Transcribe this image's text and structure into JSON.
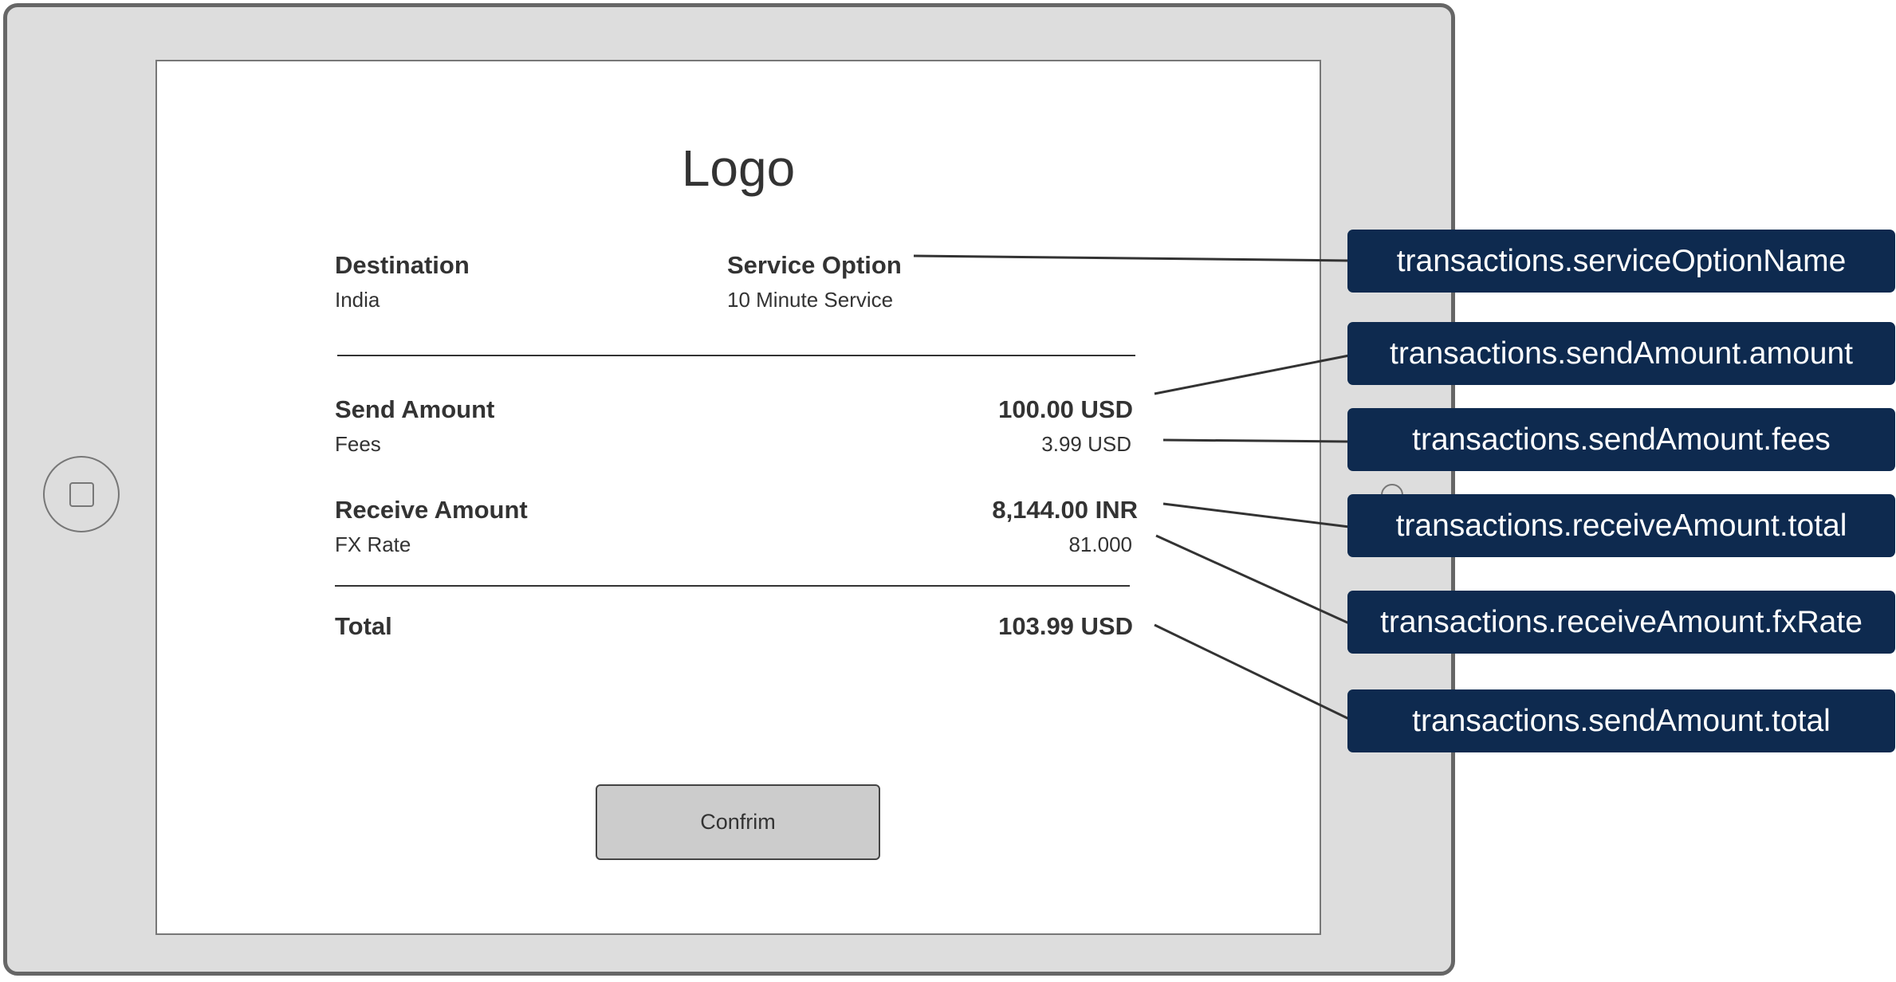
{
  "screen": {
    "logo": "Logo",
    "destination": {
      "label": "Destination",
      "value": "India"
    },
    "service_option": {
      "label": "Service Option",
      "value": "10 Minute Service"
    },
    "send_amount": {
      "label": "Send Amount",
      "value": "100.00 USD"
    },
    "fees": {
      "label": "Fees",
      "value": "3.99 USD"
    },
    "receive_amount": {
      "label": "Receive Amount",
      "value": "8,144.00 INR"
    },
    "fx_rate": {
      "label": "FX Rate",
      "value": "81.000"
    },
    "total": {
      "label": "Total",
      "value": "103.99 USD"
    },
    "confirm_label": "Confrim"
  },
  "annotations": [
    "transactions.serviceOptionName",
    "transactions.sendAmount.amount",
    "transactions.sendAmount.fees",
    "transactions.receiveAmount.total",
    "transactions.receiveAmount.fxRate",
    "transactions.sendAmount.total"
  ],
  "colors": {
    "callout_bg": "#0e2a4f",
    "device_frame": "#dddddd",
    "button_bg": "#cccccc"
  },
  "icons": [
    "home-button-icon",
    "camera-icon"
  ]
}
